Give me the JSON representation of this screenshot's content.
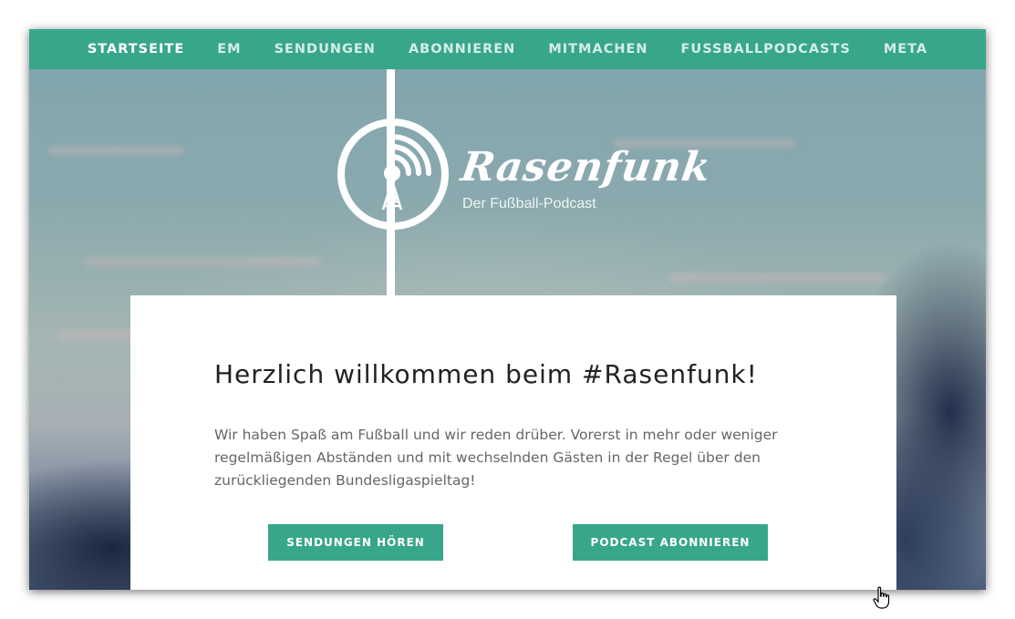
{
  "nav": {
    "items": [
      {
        "label": "STARTSEITE",
        "active": true
      },
      {
        "label": "EM",
        "active": false
      },
      {
        "label": "SENDUNGEN",
        "active": false
      },
      {
        "label": "ABONNIEREN",
        "active": false
      },
      {
        "label": "MITMACHEN",
        "active": false
      },
      {
        "label": "FUSSBALLPODCASTS",
        "active": false
      },
      {
        "label": "META",
        "active": false
      }
    ]
  },
  "brand": {
    "title": "Rasenfunk",
    "subtitle": "Der Fußball-Podcast",
    "logo_icon": "radio-tower-icon"
  },
  "welcome": {
    "heading": "Herzlich willkommen beim #Rasenfunk!",
    "text": "Wir haben Spaß am Fußball und wir reden drüber. Vorerst in mehr oder weniger regelmäßigen Abständen und mit wechselnden Gästen in der Regel über den zurückliegenden Bundesligaspieltag!",
    "buttons": {
      "listen": "SENDUNGEN HÖREN",
      "subscribe": "PODCAST ABONNIEREN"
    }
  },
  "colors": {
    "accent": "#38a68a",
    "nav_text": "#d3efe6",
    "nav_active": "#ffffff",
    "heading": "#222222",
    "body_text": "#666666"
  },
  "cursor_icon": "hand-pointer-icon"
}
